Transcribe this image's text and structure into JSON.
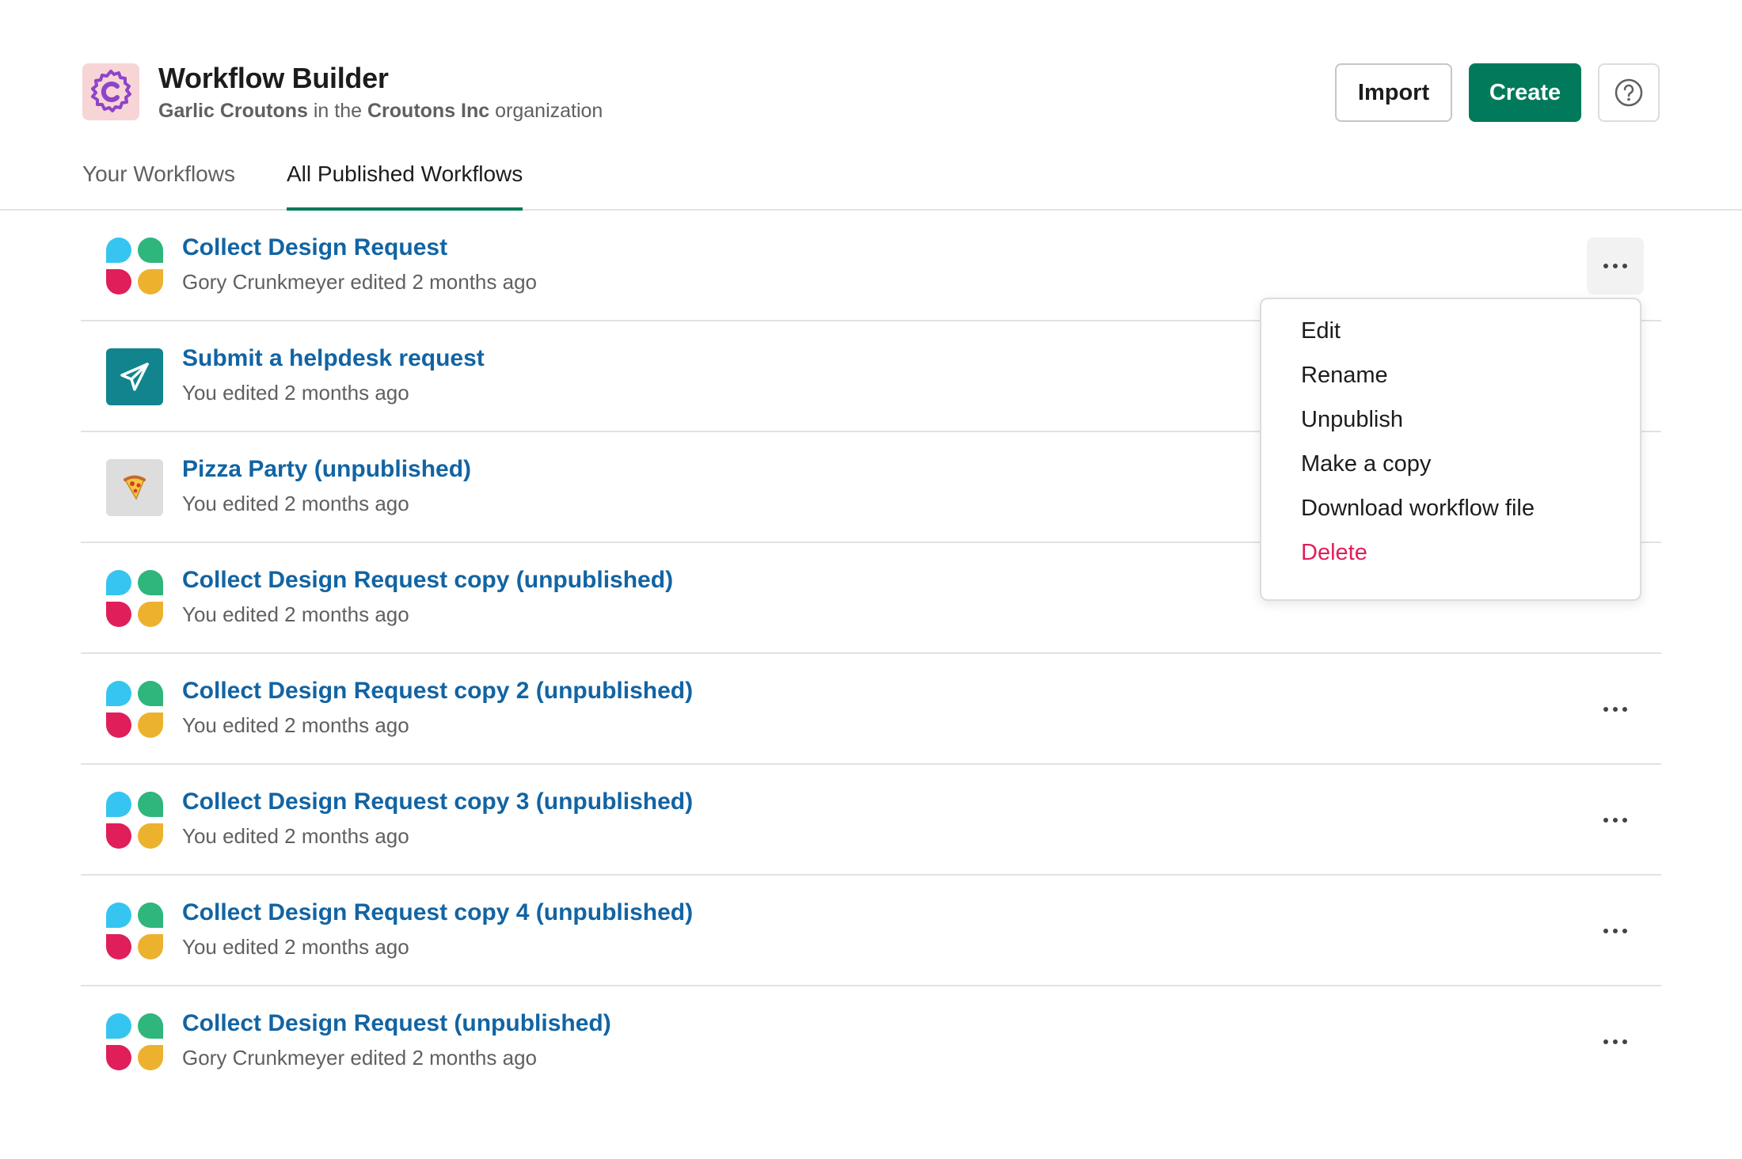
{
  "header": {
    "title": "Workflow Builder",
    "org_user": "Garlic Croutons",
    "org_mid": "in the",
    "org_name": "Croutons Inc",
    "org_suffix": "organization",
    "logo_icon": "copyright-c-icon",
    "import_label": "Import",
    "create_label": "Create",
    "help_icon": "question-circle-icon"
  },
  "tabs": [
    {
      "label": "Your Workflows",
      "active": false
    },
    {
      "label": "All Published Workflows",
      "active": true
    }
  ],
  "workflows": [
    {
      "title": "Collect Design Request",
      "subtitle": "Gory Crunkmeyer edited 2 months ago",
      "icon": "quad-blocks-icon"
    },
    {
      "title": "Submit a helpdesk request",
      "subtitle": "You edited 2 months ago",
      "icon": "paper-plane-icon"
    },
    {
      "title": "Pizza Party (unpublished)",
      "subtitle": "You edited 2 months ago",
      "icon": "pizza-icon"
    },
    {
      "title": "Collect Design Request copy (unpublished)",
      "subtitle": "You edited 2 months ago",
      "icon": "quad-blocks-icon"
    },
    {
      "title": "Collect Design Request copy 2 (unpublished)",
      "subtitle": "You edited 2 months ago",
      "icon": "quad-blocks-icon"
    },
    {
      "title": "Collect Design Request copy 3 (unpublished)",
      "subtitle": "You edited 2 months ago",
      "icon": "quad-blocks-icon"
    },
    {
      "title": "Collect Design Request copy 4 (unpublished)",
      "subtitle": "You edited 2 months ago",
      "icon": "quad-blocks-icon"
    },
    {
      "title": "Collect Design Request (unpublished)",
      "subtitle": "Gory Crunkmeyer edited 2 months ago",
      "icon": "quad-blocks-icon"
    }
  ],
  "menu": {
    "items": [
      "Edit",
      "Rename",
      "Unpublish",
      "Make a copy",
      "Download workflow file",
      "Delete"
    ]
  },
  "colors": {
    "accent_green": "#007a5a",
    "link_blue": "#1264a3",
    "danger": "#e01e5a",
    "logo_bg": "#f7d4d6",
    "logo_fg": "#8e44c8",
    "teal_icon": "#11848e",
    "quad_blue": "#36c5f0",
    "quad_green": "#2eb67d",
    "quad_red": "#e01e5a",
    "quad_yellow": "#ecb22e"
  }
}
